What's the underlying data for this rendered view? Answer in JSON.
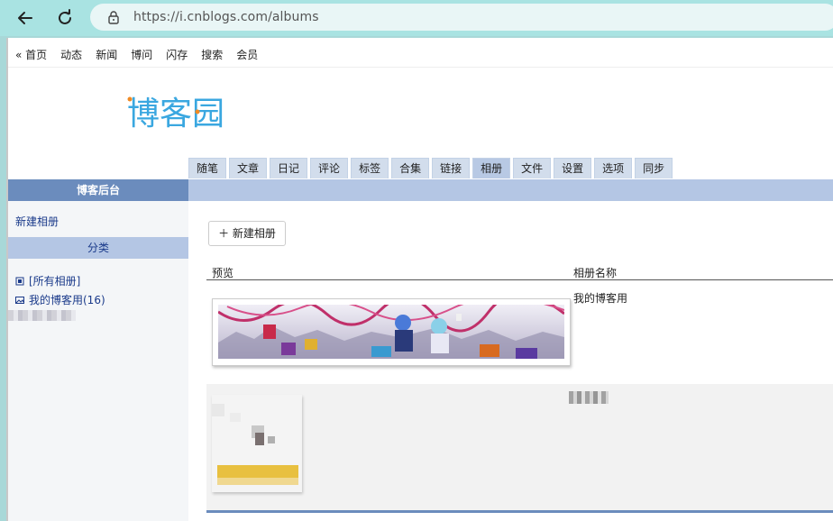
{
  "browser": {
    "url": "https://i.cnblogs.com/albums"
  },
  "top_nav": [
    "« 首页",
    "动态",
    "新闻",
    "博问",
    "闪存",
    "搜索",
    "会员"
  ],
  "logo": {
    "text": "博客园",
    "color": "#3aa7e0"
  },
  "tabs": [
    "随笔",
    "文章",
    "日记",
    "评论",
    "标签",
    "合集",
    "链接",
    "相册",
    "文件",
    "设置",
    "选项",
    "同步"
  ],
  "active_tab": "相册",
  "sidebar": {
    "header": "博客后台",
    "new_album": "新建相册",
    "category_header": "分类",
    "categories": [
      "[所有相册]",
      "我的博客用(16)"
    ]
  },
  "main": {
    "new_album_button": "＋ 新建相册",
    "columns": {
      "preview": "预览",
      "name": "相册名称"
    },
    "albums": [
      {
        "name": "我的博客用"
      }
    ]
  },
  "colors": {
    "header_blue": "#6b8cbd",
    "light_blue": "#b4c6e4",
    "tab_bg": "#d2ddec",
    "browser": "#a9e3e2"
  }
}
